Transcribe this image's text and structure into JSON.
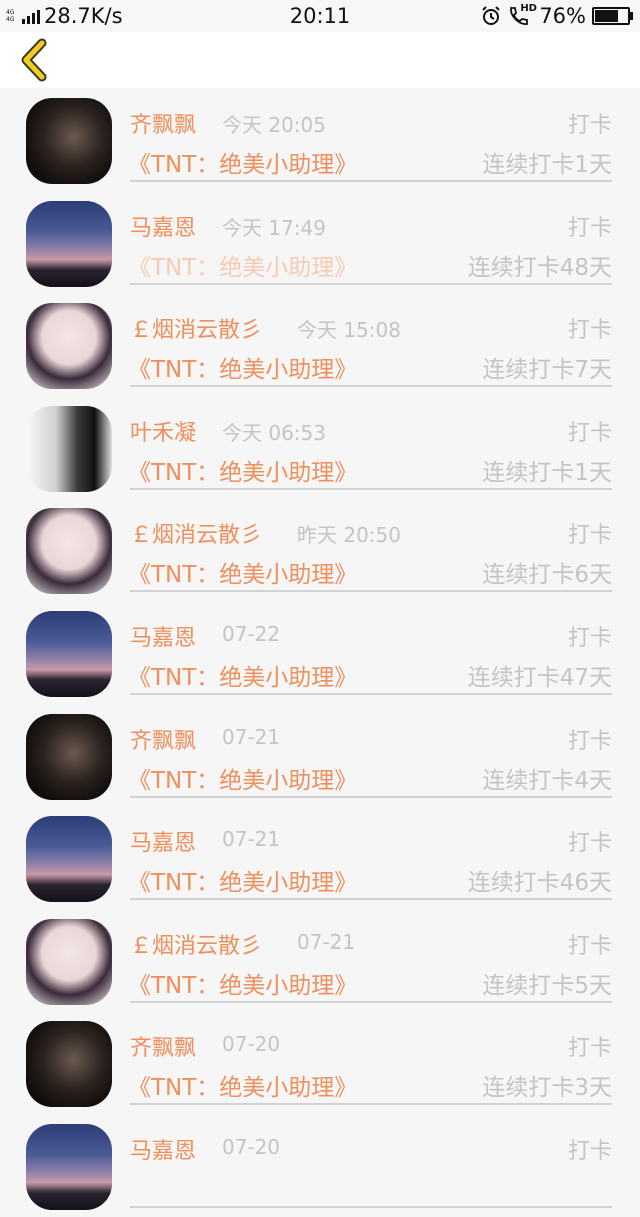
{
  "status_bar": {
    "network": "4G 4G",
    "speed": "28.7K/s",
    "time": "20:11",
    "hd_label": "HD",
    "battery": "76%",
    "battery_level": 0.76
  },
  "nav": {
    "back_icon": "chevron-left-icon",
    "accent": "#f3cc1f"
  },
  "colors": {
    "name": "#ee8f5c",
    "muted": "#c4c4c4"
  },
  "items": [
    {
      "name": "齐飘飘",
      "time": "今天 20:05",
      "action": "打卡",
      "title": "《TNT：绝美小助理》",
      "streak": "连续打卡1天",
      "avatar": "dark"
    },
    {
      "name": "马嘉恩",
      "time": "今天 17:49",
      "action": "打卡",
      "title": "《TNT：绝美小助理》",
      "streak": "连续打卡48天",
      "avatar": "sky"
    },
    {
      "name": "￡烟消云散彡",
      "time": "今天 15:08",
      "action": "打卡",
      "title": "《TNT：绝美小助理》",
      "streak": "连续打卡7天",
      "avatar": "anime"
    },
    {
      "name": "叶禾凝",
      "time": "今天 06:53",
      "action": "打卡",
      "title": "《TNT：绝美小助理》",
      "streak": "连续打卡1天",
      "avatar": "bw"
    },
    {
      "name": "￡烟消云散彡",
      "time": "昨天 20:50",
      "action": "打卡",
      "title": "《TNT：绝美小助理》",
      "streak": "连续打卡6天",
      "avatar": "anime"
    },
    {
      "name": "马嘉恩",
      "time": "07-22",
      "action": "打卡",
      "title": "《TNT：绝美小助理》",
      "streak": "连续打卡47天",
      "avatar": "sky"
    },
    {
      "name": "齐飘飘",
      "time": "07-21",
      "action": "打卡",
      "title": "《TNT：绝美小助理》",
      "streak": "连续打卡4天",
      "avatar": "dark"
    },
    {
      "name": "马嘉恩",
      "time": "07-21",
      "action": "打卡",
      "title": "《TNT：绝美小助理》",
      "streak": "连续打卡46天",
      "avatar": "sky"
    },
    {
      "name": "￡烟消云散彡",
      "time": "07-21",
      "action": "打卡",
      "title": "《TNT：绝美小助理》",
      "streak": "连续打卡5天",
      "avatar": "anime"
    },
    {
      "name": "齐飘飘",
      "time": "07-20",
      "action": "打卡",
      "title": "《TNT：绝美小助理》",
      "streak": "连续打卡3天",
      "avatar": "dark"
    },
    {
      "name": "马嘉恩",
      "time": "07-20",
      "action": "打卡",
      "title": "",
      "streak": "",
      "avatar": "sky"
    }
  ]
}
